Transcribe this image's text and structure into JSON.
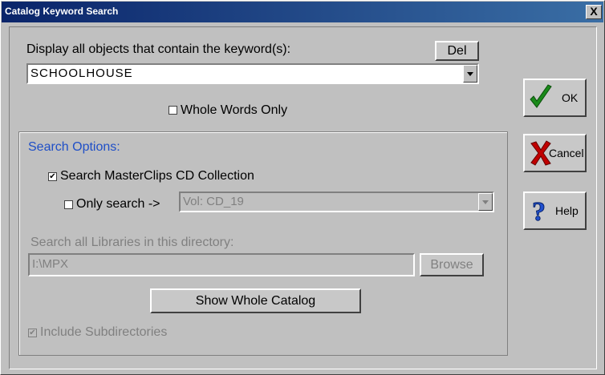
{
  "window": {
    "title": "Catalog Keyword Search",
    "close_label": "X"
  },
  "keyword": {
    "label": "Display all objects that contain the keyword(s):",
    "del_label": "Del",
    "value": "SCHOOLHOUSE",
    "whole_words_label": "Whole Words Only",
    "whole_words_checked": false
  },
  "options": {
    "heading": "Search Options:",
    "masterclips_label": "Search MasterClips CD Collection",
    "masterclips_checked": true,
    "only_search_label": "Only search ->",
    "only_search_checked": false,
    "volume_value": "Vol: CD_19",
    "libraries_label": "Search all Libraries in this directory:",
    "directory_value": "I:\\MPX",
    "browse_label": "Browse",
    "show_catalog_label": "Show Whole Catalog",
    "include_subdirs_label": "Include Subdirectories",
    "include_subdirs_checked": true
  },
  "side_buttons": {
    "ok_label": "OK",
    "cancel_label": "Cancel",
    "help_label": "Help"
  },
  "colors": {
    "titlebar": "#0a246a",
    "accent_blue": "#1f4fc7",
    "ok_green": "#1a8a1a",
    "cancel_red": "#c00000",
    "help_blue": "#2050d0"
  }
}
